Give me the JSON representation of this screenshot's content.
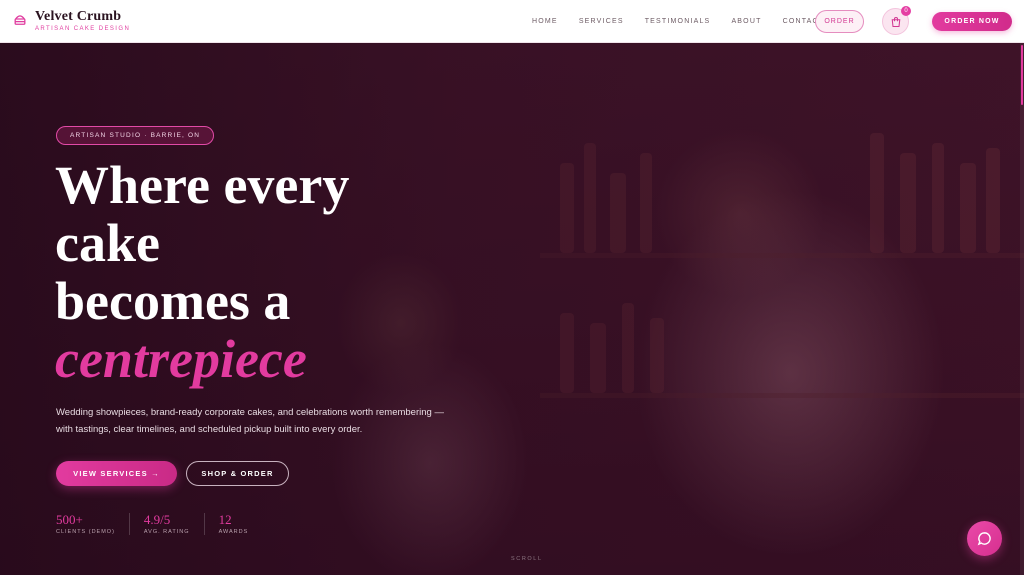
{
  "brand": {
    "name": "Velvet Crumb",
    "tagline": "ARTISAN CAKE DESIGN"
  },
  "nav": {
    "items": [
      {
        "label": "HOME"
      },
      {
        "label": "SERVICES"
      },
      {
        "label": "TESTIMONIALS"
      },
      {
        "label": "ABOUT"
      },
      {
        "label": "CONTACT"
      }
    ],
    "order_label": "ORDER",
    "cart_count": "0",
    "order_now_label": "ORDER NOW"
  },
  "hero": {
    "badge": "ARTISAN STUDIO · BARRIE, ON",
    "headline_lines": [
      "Where every",
      "cake",
      "becomes a"
    ],
    "headline_accent": "centrepiece",
    "subtitle": "Wedding showpieces, brand-ready corporate cakes, and celebrations worth remembering — with tastings, clear timelines, and scheduled pickup built into every order.",
    "primary_button": "VIEW SERVICES →",
    "secondary_button": "SHOP & ORDER",
    "stats": [
      {
        "value": "500+",
        "label": "CLIENTS (DEMO)"
      },
      {
        "value": "4.9/5",
        "label": "AVG. RATING"
      },
      {
        "value": "12",
        "label": "AWARDS"
      }
    ],
    "scroll_label": "SCROLL"
  },
  "colors": {
    "accent": "#e23b9f",
    "header_bg": "#ffffff",
    "hero_bg": "#33101f"
  },
  "icons": {
    "brand": "cake-icon",
    "cart": "shopping-bag-icon",
    "chat": "chat-bubble-icon"
  }
}
